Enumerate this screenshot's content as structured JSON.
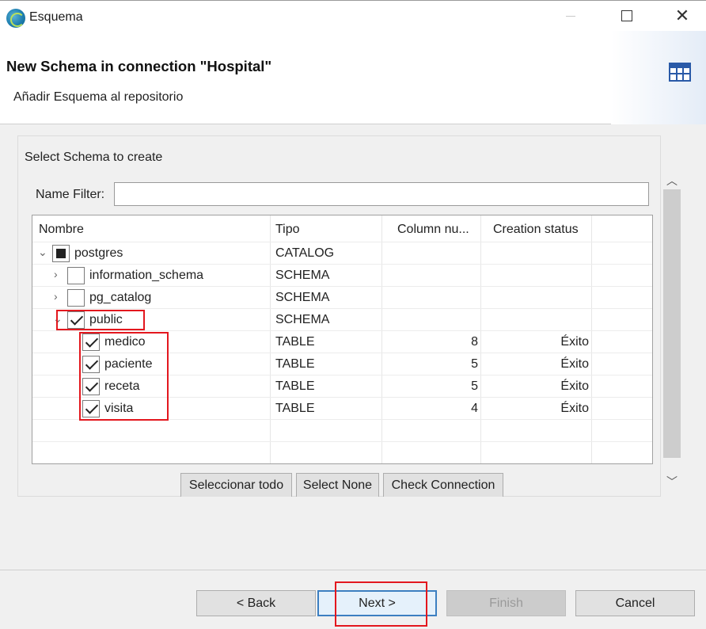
{
  "window": {
    "title": "Esquema"
  },
  "header": {
    "title": "New Schema in connection \"Hospital\"",
    "subtitle": "Añadir Esquema al repositorio"
  },
  "group": {
    "title": "Select Schema to create",
    "filter_label": "Name Filter:",
    "filter_value": ""
  },
  "table": {
    "columns": [
      "Nombre",
      "Tipo",
      "Column nu...",
      "Creation status"
    ],
    "rows": [
      {
        "name": "postgres",
        "type": "CATALOG",
        "columns": "",
        "status": "",
        "level": 0,
        "expander": "expanded",
        "check": "partial"
      },
      {
        "name": "information_schema",
        "type": "SCHEMA",
        "columns": "",
        "status": "",
        "level": 1,
        "expander": "collapsed",
        "check": "unchecked"
      },
      {
        "name": "pg_catalog",
        "type": "SCHEMA",
        "columns": "",
        "status": "",
        "level": 1,
        "expander": "collapsed",
        "check": "unchecked"
      },
      {
        "name": "public",
        "type": "SCHEMA",
        "columns": "",
        "status": "",
        "level": 1,
        "expander": "expanded",
        "check": "checked"
      },
      {
        "name": "medico",
        "type": "TABLE",
        "columns": "8",
        "status": "Éxito",
        "level": 2,
        "expander": "none",
        "check": "checked"
      },
      {
        "name": "paciente",
        "type": "TABLE",
        "columns": "5",
        "status": "Éxito",
        "level": 2,
        "expander": "none",
        "check": "checked"
      },
      {
        "name": "receta",
        "type": "TABLE",
        "columns": "5",
        "status": "Éxito",
        "level": 2,
        "expander": "none",
        "check": "checked"
      },
      {
        "name": "visita",
        "type": "TABLE",
        "columns": "4",
        "status": "Éxito",
        "level": 2,
        "expander": "none",
        "check": "checked"
      }
    ]
  },
  "actions": {
    "select_all": "Seleccionar todo",
    "select_none": "Select None",
    "check_connection": "Check Connection"
  },
  "footer": {
    "back": "< Back",
    "next": "Next >",
    "finish": "Finish",
    "cancel": "Cancel"
  },
  "colors": {
    "highlight": "#e3171e",
    "default_button_border": "#3c7fc1"
  }
}
